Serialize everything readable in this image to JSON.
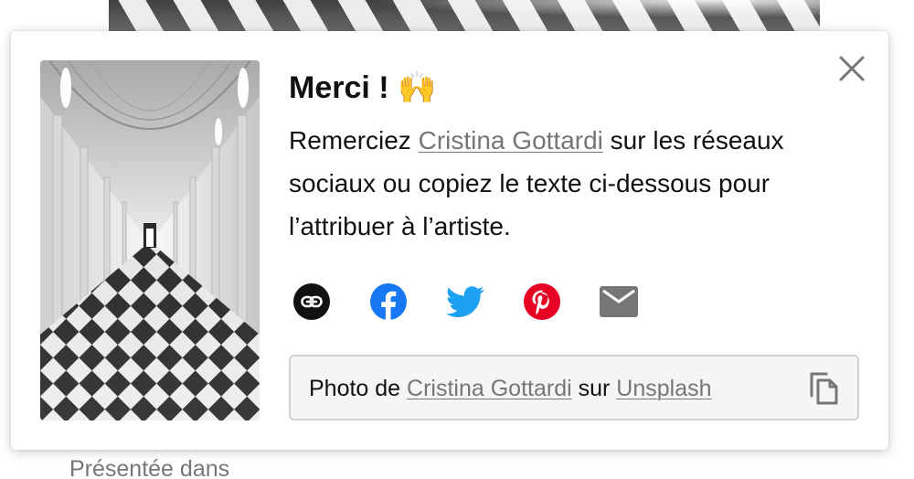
{
  "modal": {
    "title": "Merci !",
    "title_emoji": "🙌",
    "description": {
      "before": "Remerciez ",
      "artist": "Cristina Gottardi",
      "after": " sur les réseaux sociaux ou copiez le texte ci-dessous pour l’attribuer à l’artiste."
    },
    "share": [
      {
        "icon": "link-icon",
        "color": "#111111"
      },
      {
        "icon": "facebook-icon",
        "color": "#1877F2"
      },
      {
        "icon": "twitter-icon",
        "color": "#1DA1F2"
      },
      {
        "icon": "pinterest-icon",
        "color": "#E60023"
      },
      {
        "icon": "email-icon",
        "color": "#767676"
      }
    ],
    "attribution": {
      "prefix": "Photo de ",
      "artist": "Cristina Gottardi",
      "middle": " sur ",
      "source": "Unsplash"
    },
    "close_icon": "close-icon",
    "copy_icon": "copy-icon"
  },
  "background": {
    "featured_label": "Présentée dans"
  }
}
